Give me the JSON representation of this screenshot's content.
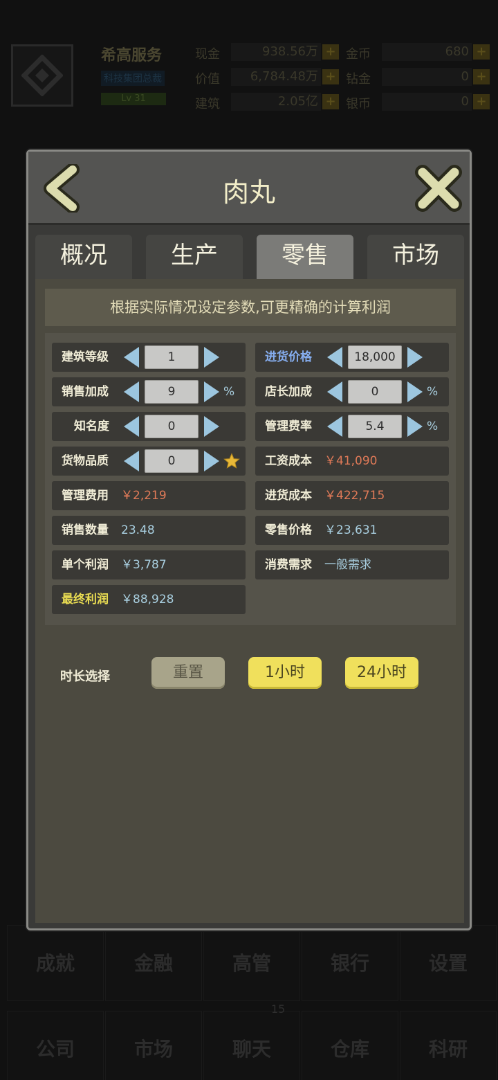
{
  "background": {
    "company_name": "希高服务",
    "tag": "科技集团总裁",
    "level": "Lv 31",
    "stats": [
      {
        "label": "现金",
        "value": "938.56万"
      },
      {
        "label": "价值",
        "value": "6,784.48万"
      },
      {
        "label": "建筑",
        "value": "2.05亿"
      },
      {
        "label": "金币",
        "value": "680"
      },
      {
        "label": "钻金",
        "value": "0"
      },
      {
        "label": "银币",
        "value": "0"
      }
    ],
    "nav_row1": [
      "成就",
      "金融",
      "高管",
      "银行",
      "设置"
    ],
    "nav_row2": [
      "公司",
      "市场",
      "聊天",
      "仓库",
      "科研"
    ],
    "chat_badge": "15"
  },
  "dialog": {
    "title": "肉丸",
    "tabs": [
      {
        "label": "概况",
        "active": false
      },
      {
        "label": "生产",
        "active": false
      },
      {
        "label": "零售",
        "active": true
      },
      {
        "label": "市场",
        "active": false
      }
    ],
    "notice": "根据实际情况设定参数,可更精确的计算利润",
    "fields": {
      "building_level": {
        "label": "建筑等级",
        "value": "1"
      },
      "purchase_price": {
        "label": "进货价格",
        "value": "18,000"
      },
      "sales_bonus": {
        "label": "销售加成",
        "value": "9",
        "unit": "%"
      },
      "manager_bonus": {
        "label": "店长加成",
        "value": "0",
        "unit": "%"
      },
      "popularity": {
        "label": "知名度",
        "value": "0"
      },
      "management_rate": {
        "label": "管理费率",
        "value": "5.4",
        "unit": "%"
      },
      "goods_quality": {
        "label": "货物品质",
        "value": "0"
      },
      "wage_cost": {
        "label": "工资成本",
        "value": "￥41,090"
      },
      "management_fee": {
        "label": "管理费用",
        "value": "￥2,219"
      },
      "purchase_cost": {
        "label": "进货成本",
        "value": "￥422,715"
      },
      "sales_quantity": {
        "label": "销售数量",
        "value": "23.48"
      },
      "retail_price": {
        "label": "零售价格",
        "value": "￥23,631"
      },
      "unit_profit": {
        "label": "单个利润",
        "value": "￥3,787"
      },
      "demand": {
        "label": "消费需求",
        "value": "一般需求"
      },
      "final_profit": {
        "label": "最终利润",
        "value": "￥88,928"
      }
    },
    "duration": {
      "label": "时长选择",
      "reset": "重置",
      "one_hour": "1小时",
      "twenty_four_hours": "24小时"
    }
  },
  "colors": {
    "accent_yellow": "#f0e05c",
    "cost_red": "#e07a58",
    "value_cyan": "#a9cfe0",
    "label_blue": "#86aef0",
    "profit_yellow": "#e9dc52"
  }
}
